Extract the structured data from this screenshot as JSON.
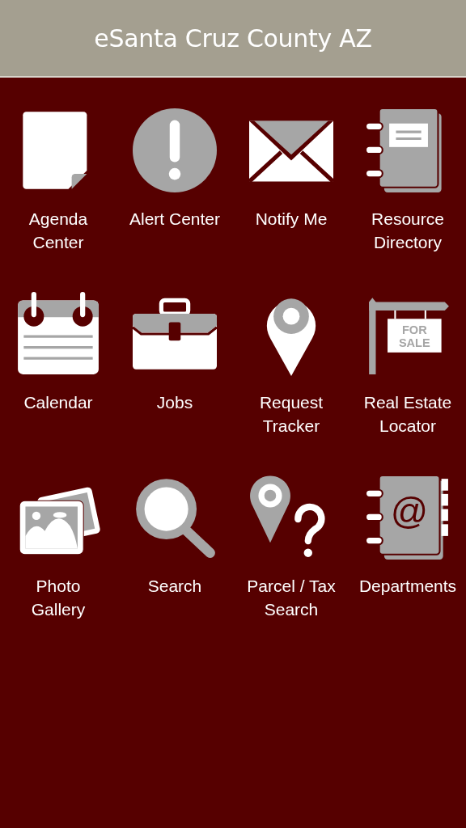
{
  "header": {
    "title": "eSanta Cruz County AZ"
  },
  "tiles": [
    {
      "kind": "document",
      "label": "Agenda\nCenter"
    },
    {
      "kind": "alert",
      "label": "Alert Center"
    },
    {
      "kind": "envelope",
      "label": "Notify Me"
    },
    {
      "kind": "notebook",
      "label": "Resource\nDirectory"
    },
    {
      "kind": "calendar",
      "label": "Calendar"
    },
    {
      "kind": "briefcase",
      "label": "Jobs"
    },
    {
      "kind": "pin",
      "label": "Request\nTracker"
    },
    {
      "kind": "sign",
      "label": "Real Estate\nLocator",
      "icon_text": [
        "FOR",
        "SALE"
      ]
    },
    {
      "kind": "photos",
      "label": "Photo\nGallery"
    },
    {
      "kind": "magnifier",
      "label": "Search"
    },
    {
      "kind": "pin-question",
      "label": "Parcel / Tax\nSearch"
    },
    {
      "kind": "address-book",
      "label": "Departments",
      "icon_text": [
        "@"
      ]
    }
  ]
}
